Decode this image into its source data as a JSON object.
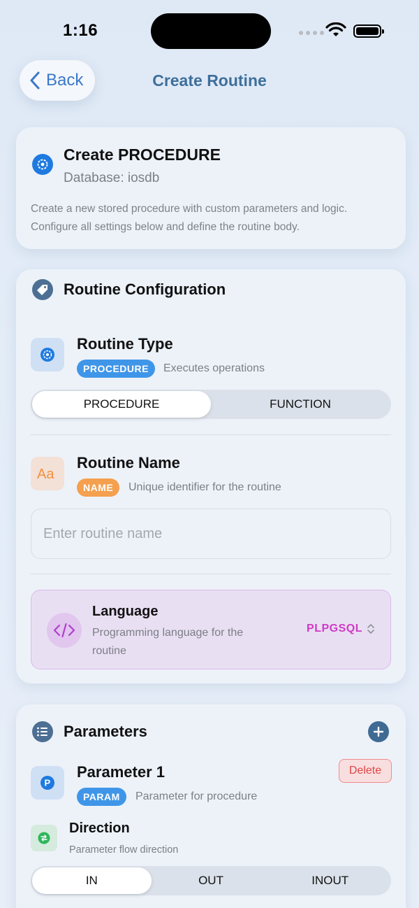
{
  "status": {
    "time": "1:16"
  },
  "nav": {
    "back_label": "Back",
    "title": "Create Routine"
  },
  "header": {
    "title": "Create PROCEDURE",
    "database": "Database: iosdb",
    "description": "Create a new stored procedure with custom parameters and logic. Configure all settings below and define the routine body."
  },
  "config": {
    "section_title": "Routine Configuration",
    "routine_type": {
      "title": "Routine Type",
      "badge": "PROCEDURE",
      "hint": "Executes operations",
      "options": [
        "PROCEDURE",
        "FUNCTION"
      ],
      "selected": "PROCEDURE"
    },
    "routine_name": {
      "title": "Routine Name",
      "badge": "NAME",
      "hint": "Unique identifier for the routine",
      "value": "",
      "placeholder": "Enter routine name"
    },
    "language": {
      "title": "Language",
      "description": "Programming language for the routine",
      "value": "PLPGSQL"
    }
  },
  "parameters": {
    "section_title": "Parameters",
    "items": [
      {
        "title": "Parameter 1",
        "badge": "PARAM",
        "hint": "Parameter for procedure",
        "delete_label": "Delete",
        "direction": {
          "title": "Direction",
          "hint": "Parameter flow direction",
          "options": [
            "IN",
            "OUT",
            "INOUT"
          ],
          "selected": "IN"
        }
      }
    ]
  },
  "colors": {
    "accent": "#3b78c9",
    "badge_blue": "#3f96e8",
    "badge_orange": "#f4a04e",
    "language_value": "#cf3bc6",
    "delete": "#e04646"
  },
  "icons": {
    "header": "gear-icon",
    "config": "tag-icon",
    "routine_type": "gear-icon",
    "routine_name": "text-format-icon",
    "language": "code-icon",
    "parameters": "list-icon",
    "add": "plus-circle-icon",
    "parameter": "p-circle-icon",
    "direction": "arrows-swap-icon"
  }
}
